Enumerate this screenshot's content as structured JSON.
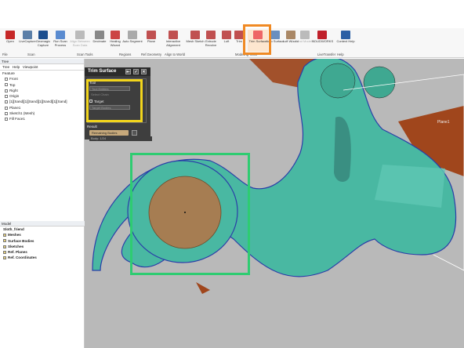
{
  "ribbon": {
    "buttons": [
      {
        "id": "open",
        "label": "Open",
        "color": "#c62828"
      },
      {
        "id": "livecapture",
        "label": "LiveCapture",
        "color": "#5b7fa8"
      },
      {
        "id": "geomagic-capture",
        "label": "Geomagic Capture",
        "color": "#1d4f8f"
      },
      {
        "id": "run-scan-process",
        "label": "Run Scan Process",
        "color": "#5a8bd0"
      },
      {
        "id": "align-between-scan-data",
        "label": "Align Between Scan Data",
        "color": "#bbbbbb",
        "disabled": true
      },
      {
        "id": "decimate",
        "label": "Decimate",
        "color": "#888888"
      },
      {
        "id": "healing-wizard",
        "label": "Healing Wizard",
        "color": "#c44"
      },
      {
        "id": "auto-segment",
        "label": "Auto Segment",
        "color": "#aaa"
      },
      {
        "id": "plane",
        "label": "Plane",
        "color": "#c05050"
      },
      {
        "id": "interactive-alignment",
        "label": "Interactive Alignment",
        "color": "#c05050"
      },
      {
        "id": "mesh-sketch",
        "label": "Mesh Sketch",
        "color": "#c05050"
      },
      {
        "id": "extrude-revolve",
        "label": "Extrude Revolve",
        "color": "#c05050"
      },
      {
        "id": "loft",
        "label": "Loft",
        "color": "#c05050"
      },
      {
        "id": "trim",
        "label": "Trim",
        "color": "#c05050"
      },
      {
        "id": "trim-surface",
        "label": "Trim Surface",
        "color": "#e66",
        "active": true
      },
      {
        "id": "auto-surface",
        "label": "Auto Surface",
        "color": "#6a8fbf"
      },
      {
        "id": "loft-wizard",
        "label": "Loft Wizard",
        "color": "#a86"
      },
      {
        "id": "send-to-modeler",
        "label": "Send Modeler",
        "color": "#bbb",
        "disabled": true
      },
      {
        "id": "solidworks",
        "label": "SOLIDWORKS",
        "color": "#c0202a"
      },
      {
        "id": "context-help",
        "label": "Context Help",
        "color": "#2a5fa5"
      }
    ],
    "groups": [
      "File",
      "Scan",
      "Scan Tools",
      "Regions",
      "Ref.Geometry",
      "Align to World",
      "Modeling Tools",
      "",
      "",
      "LiveTransfer",
      "Help"
    ]
  },
  "left_panel": {
    "tabs": [
      "Tree",
      "Help",
      "Viewpoint"
    ],
    "feature_header": "Feature",
    "features": [
      "Front",
      "Top",
      "Right",
      "Origin",
      "[1][Sand][1][Sand][1][Sand][1][Sand]",
      "Plane1",
      "Sketch1 (Mesh)",
      "Fill Face1"
    ],
    "model_header": "Model",
    "model_title": "Sloth_friend",
    "model_items": [
      "Meshes",
      "Surface Bodies",
      "Sketches",
      "Ref. Planes",
      "Ref. Coordinates"
    ]
  },
  "property_panel": {
    "title": "Trim Surface",
    "tool_section": "Tool",
    "tool_entities": "Tool Entities",
    "select_chain": "Select Chain",
    "target_section": "Target",
    "target_bodies": "Target Bodies",
    "result_section": "Result",
    "remaining_bodies": "Remaining Bodies",
    "body_label": "Body: 1/24"
  },
  "viewport": {
    "plane_label": "Plane1"
  },
  "colors": {
    "highlight_orange": "#f08a24",
    "highlight_yellow": "#f2d51c",
    "highlight_green": "#2ecc71",
    "mesh_teal": "#49b8a2",
    "disc_tan": "#a67d52"
  }
}
